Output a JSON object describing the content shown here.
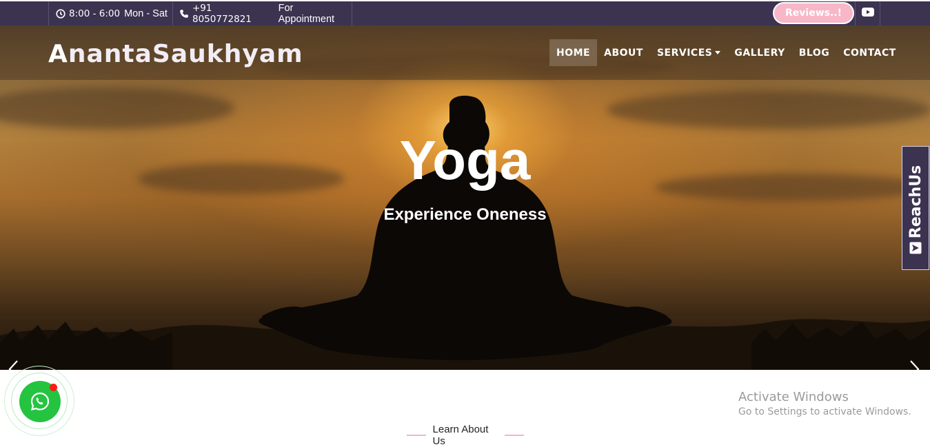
{
  "topbar": {
    "hours_time": "8:00 - 6:00",
    "hours_days": "Mon - Sat",
    "phone": "+91 8050772821",
    "phone_note": "For Appointment",
    "reviews_label": "Reviews..!",
    "colors": {
      "bar_bg": "#3b3350",
      "reviews_bg": "#f8b7c8"
    },
    "icons": [
      "clock-icon",
      "phone-icon",
      "youtube-icon"
    ]
  },
  "header": {
    "logo": "AnantaSaukhyam",
    "nav": [
      {
        "label": "HOME",
        "active": true
      },
      {
        "label": "ABOUT"
      },
      {
        "label": "SERVICES",
        "dropdown": true
      },
      {
        "label": "GALLERY"
      },
      {
        "label": "BLOG"
      },
      {
        "label": "CONTACT"
      }
    ]
  },
  "hero": {
    "title": "Yoga",
    "subtitle": "Experience Oneness"
  },
  "reach_us": {
    "label": "ReachUs",
    "icon": "paper-plane-icon"
  },
  "section": {
    "heading": "Learn About Us"
  },
  "windows_watermark": {
    "title": "Activate Windows",
    "note": "Go to Settings to activate Windows."
  },
  "whatsapp": {
    "icon": "whatsapp-icon",
    "color": "#25c440"
  }
}
